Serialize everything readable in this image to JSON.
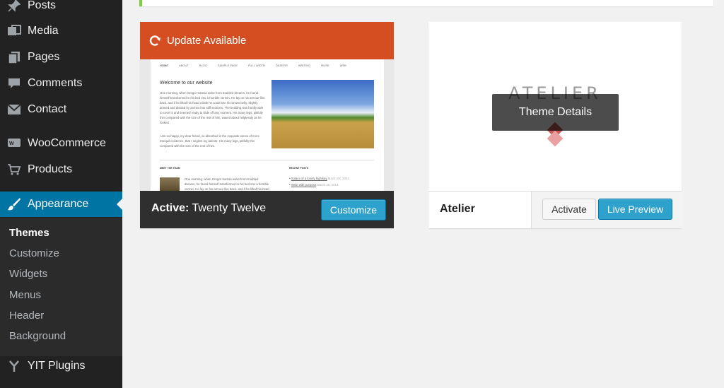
{
  "sidebar": {
    "items": [
      {
        "label": "Posts",
        "icon": "pin-icon"
      },
      {
        "label": "Media",
        "icon": "media-icon"
      },
      {
        "label": "Pages",
        "icon": "pages-icon"
      },
      {
        "label": "Comments",
        "icon": "comments-icon"
      },
      {
        "label": "Contact",
        "icon": "mail-icon"
      },
      {
        "label": "WooCommerce",
        "icon": "woocommerce-icon"
      },
      {
        "label": "Products",
        "icon": "cart-icon"
      },
      {
        "label": "Appearance",
        "icon": "brush-icon"
      },
      {
        "label": "YIT Plugins",
        "icon": "yit-icon"
      }
    ],
    "submenu": [
      "Themes",
      "Customize",
      "Widgets",
      "Menus",
      "Header",
      "Background"
    ],
    "active_item": "Appearance",
    "current_subitem": "Themes"
  },
  "themes": {
    "active": {
      "update_label": "Update Available",
      "active_prefix": "Active:",
      "name": "Twenty Twelve",
      "customize_label": "Customize",
      "preview": {
        "nav": [
          "HOME",
          "ABOUT",
          "BLOG",
          "SAMPLE PAGE",
          "FULL WIDTH",
          "DATEPIS",
          "WRITING",
          "MUSE",
          "WEB"
        ],
        "title": "Welcome to our website",
        "paragraph1": "One morning, when Gregor Samsa woke from troubled dreams, he found himself transformed in his bed into a horrible vermin. He lay on his armour-like back, and if he lifted his head a little he could see his brown belly, slightly domed and divided by arches into stiff sections. The bedding was hardly able to cover it and seemed ready to slide off any moment. His many legs, pitifully thin compared with the size of the rest of him, waved about helplessly as he looked.",
        "paragraph2": "I am so happy, my dear friend, so absorbed in the exquisite sense of mere tranquil existence, that I neglect my talents. His many legs, pitifully thin compared with the size of the rest of him.",
        "section_left": "MEET THE TEAM",
        "section_right": "RECENT POSTS",
        "team_text": "One morning, when Gregor Samsa woke from troubled dreams, he found himself transformed in his bed into a horrible vermin. He lay on his armour-like back, and if he lifted his head a little",
        "recent_posts": [
          {
            "title": "Solace of a lonely highway",
            "date": "March 28, 2013"
          },
          {
            "title": "Write with purpose",
            "date": "March 28, 2013"
          }
        ]
      }
    },
    "other": {
      "logo_text": "ATELIER",
      "details_label": "Theme Details",
      "name": "Atelier",
      "activate_label": "Activate",
      "live_preview_label": "Live Preview"
    }
  },
  "colors": {
    "sidebar_bg": "#222222",
    "active_blue": "#0074a2",
    "button_blue": "#2ea2cc",
    "update_orange": "#d54e21",
    "notice_green": "#7ad03a"
  }
}
